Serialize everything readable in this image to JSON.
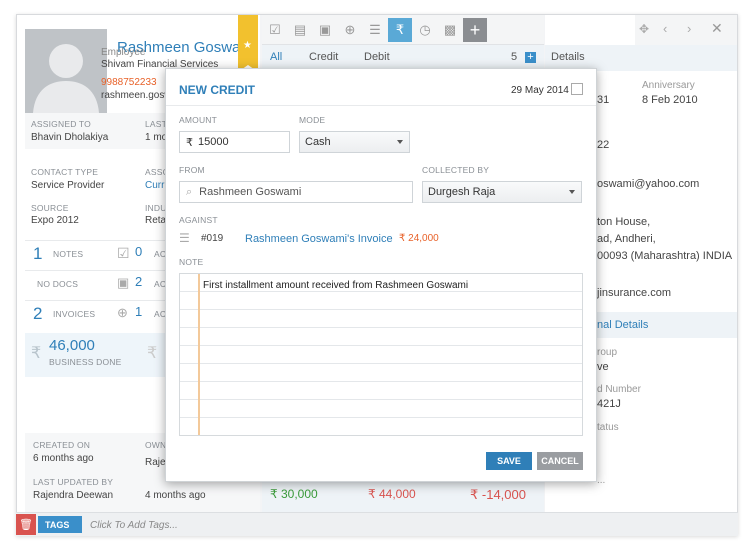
{
  "profile": {
    "name": "Rashmeen Goswami",
    "role": "Employee",
    "company": "Shivam Financial Services",
    "phone": "9988752233",
    "email": "rashmeen.gosw",
    "assigned_to_label": "ASSIGNED TO",
    "assigned_to": "Bhavin Dholakiya",
    "last_label": "LAST",
    "last_value": "1 mo",
    "contact_type_label": "CONTACT TYPE",
    "contact_type": "Service Provider",
    "asso_label": "ASSO",
    "asso_value": "Curr",
    "source_label": "SOURCE",
    "source": "Expo 2012",
    "indu_label": "INDUS",
    "indu_value": "Retai",
    "notes_count": "1",
    "notes_label": "NOTES",
    "notes_side": "0",
    "docs_label": "NO DOCS",
    "docs_side": "2",
    "invoices_count": "2",
    "invoices_label": "INVOICES",
    "invoices_side": "1",
    "side_suffix": "ac",
    "business_value": "46,000",
    "business_label": "BUSINESS DONE",
    "rupee": "₹"
  },
  "meta": {
    "created_on_label": "CREATED ON",
    "created_on": "6 months ago",
    "owner_label": "OWNE",
    "owner": "Rajen",
    "last_updated_by_label": "LAST UPDATED BY",
    "last_updated_by": "Rajendra Deewan",
    "last_updated_on": "4 months ago"
  },
  "tabs": {
    "all": "All",
    "credit": "Credit",
    "debit": "Debit",
    "count": "5",
    "details": "Details"
  },
  "totals": {
    "credit": "₹ 30,000",
    "debit": "₹ 44,000",
    "balance": "₹ -14,000"
  },
  "details": {
    "anniversary_label": "Anniversary",
    "anniversary": "8 Feb 2010",
    "dob_fragment": "31",
    "phone_fragment": "22",
    "email_fragment": "oswami@yahoo.com",
    "addr1": "ton House,",
    "addr2": "ad, Andheri,",
    "addr3": "00093 (Maharashtra) INDIA",
    "web": "jinsurance.com",
    "personal_details": "nal Details",
    "group_label": "roup",
    "group": "ve",
    "number_label": "d Number",
    "number": "421J",
    "status_label": "tatus",
    "extra": "..."
  },
  "tags": {
    "label": "TAGS",
    "placeholder": "Click To Add Tags..."
  },
  "modal": {
    "title": "NEW CREDIT",
    "date": "29 May 2014",
    "amount_label": "AMOUNT",
    "amount_prefix": "₹",
    "amount": "15000",
    "mode_label": "MODE",
    "mode": "Cash",
    "from_label": "FROM",
    "from": "Rashmeen Goswami",
    "collected_by_label": "COLLECTED BY",
    "collected_by": "Durgesh Raja",
    "against_label": "AGAINST",
    "invoice_no": "#019",
    "invoice_name": "Rashmeen Goswami's Invoice",
    "invoice_amount": "₹ 24,000",
    "note_label": "NOTE",
    "note": "First installment amount received from Rashmeen Goswami",
    "save": "SAVE",
    "cancel": "CANCEL"
  },
  "colors": {
    "accent": "#2f7fb8",
    "pin": "#f2c12e",
    "active_tab": "#5aa9d6",
    "credit_green": "#3a9b3a",
    "debit_red": "#d9534f",
    "orange": "#e8622a"
  }
}
